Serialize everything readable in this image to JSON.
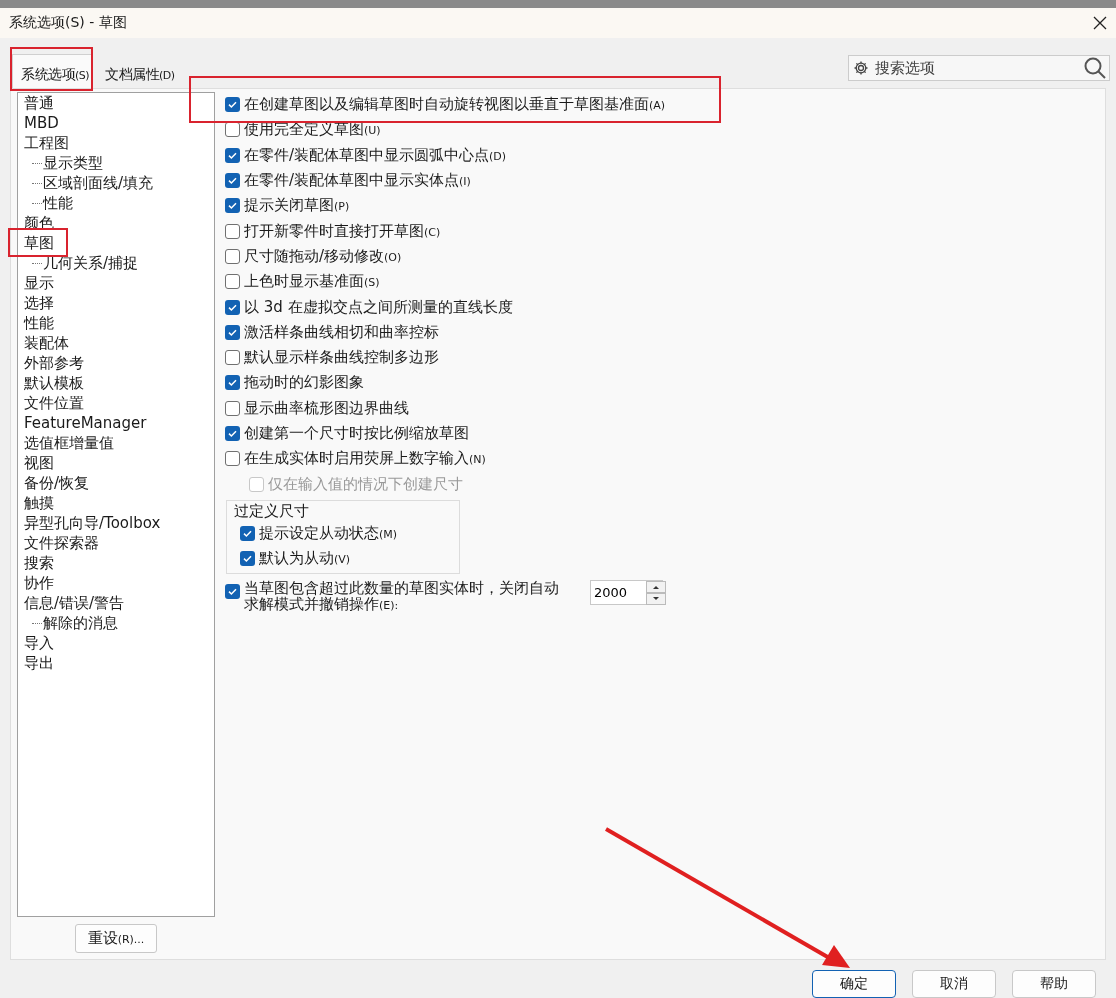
{
  "window": {
    "title": "系统选项(S) - 草图"
  },
  "tabs": [
    {
      "label": "系统选项",
      "accel": "(S)",
      "selected": true
    },
    {
      "label": "文档属性",
      "accel": "(D)",
      "selected": false
    }
  ],
  "search": {
    "placeholder": "搜索选项"
  },
  "sidebar": {
    "items": [
      {
        "label": "普通"
      },
      {
        "label": "MBD"
      },
      {
        "label": "工程图",
        "children": [
          {
            "label": "显示类型"
          },
          {
            "label": "区域剖面线/填充"
          },
          {
            "label": "性能"
          }
        ]
      },
      {
        "label": "颜色"
      },
      {
        "label": "草图",
        "children": [
          {
            "label": "几何关系/捕捉"
          }
        ]
      },
      {
        "label": "显示"
      },
      {
        "label": "选择"
      },
      {
        "label": "性能"
      },
      {
        "label": "装配体"
      },
      {
        "label": "外部参考"
      },
      {
        "label": "默认模板"
      },
      {
        "label": "文件位置"
      },
      {
        "label": "FeatureManager"
      },
      {
        "label": "选值框增量值"
      },
      {
        "label": "视图"
      },
      {
        "label": "备份/恢复"
      },
      {
        "label": "触摸"
      },
      {
        "label": "异型孔向导/Toolbox"
      },
      {
        "label": "文件探索器"
      },
      {
        "label": "搜索"
      },
      {
        "label": "协作"
      },
      {
        "label": "信息/错误/警告",
        "children": [
          {
            "label": "解除的消息"
          }
        ]
      },
      {
        "label": "导入"
      },
      {
        "label": "导出"
      }
    ],
    "reset_button": {
      "label": "重设",
      "accel": "(R)..."
    }
  },
  "options": [
    {
      "kind": "checkbox",
      "label": "在创建草图以及编辑草图时自动旋转视图以垂直于草图基准面",
      "accel": "(A)",
      "checked": true
    },
    {
      "kind": "checkbox",
      "label": "使用完全定义草图",
      "accel": "(U)",
      "checked": false
    },
    {
      "kind": "checkbox",
      "label": "在零件/装配体草图中显示圆弧中心点",
      "accel": "(D)",
      "checked": true
    },
    {
      "kind": "checkbox",
      "label": "在零件/装配体草图中显示实体点",
      "accel": "(I)",
      "checked": true
    },
    {
      "kind": "checkbox",
      "label": "提示关闭草图",
      "accel": "(P)",
      "checked": true
    },
    {
      "kind": "checkbox",
      "label": "打开新零件时直接打开草图",
      "accel": "(C)",
      "checked": false
    },
    {
      "kind": "checkbox",
      "label": "尺寸随拖动/移动修改",
      "accel": "(O)",
      "checked": false
    },
    {
      "kind": "checkbox",
      "label": "上色时显示基准面",
      "accel": "(S)",
      "checked": false
    },
    {
      "kind": "checkbox",
      "label": "以 3d 在虚拟交点之间所测量的直线长度",
      "checked": true
    },
    {
      "kind": "checkbox",
      "label": "激活样条曲线相切和曲率控标",
      "checked": true
    },
    {
      "kind": "checkbox",
      "label": "默认显示样条曲线控制多边形",
      "checked": false
    },
    {
      "kind": "checkbox",
      "label": "拖动时的幻影图象",
      "checked": true
    },
    {
      "kind": "checkbox",
      "label": "显示曲率梳形图边界曲线",
      "checked": false
    },
    {
      "kind": "checkbox",
      "label": "创建第一个尺寸时按比例缩放草图",
      "checked": true
    },
    {
      "kind": "checkbox",
      "label": "在生成实体时启用荧屏上数字输入",
      "accel": "(N)",
      "checked": false,
      "children": [
        {
          "kind": "checkbox",
          "label": "仅在输入值的情况下创建尺寸",
          "checked": false,
          "disabled": true
        }
      ]
    },
    {
      "kind": "group",
      "title": "过定义尺寸",
      "children": [
        {
          "kind": "checkbox",
          "label": "提示设定从动状态",
          "accel": "(M)",
          "checked": true
        },
        {
          "kind": "checkbox",
          "label": "默认为从动",
          "accel": "(V)",
          "checked": true
        }
      ]
    },
    {
      "kind": "spin",
      "label": "当草图包含超过此数量的草图实体时，关闭自动求解模式并撤销操作",
      "accel": "(E):",
      "checked": true,
      "value": "2000"
    }
  ],
  "buttons": [
    {
      "label": "确定",
      "default": true
    },
    {
      "label": "取消",
      "default": false
    },
    {
      "label": "帮助",
      "default": false
    }
  ]
}
